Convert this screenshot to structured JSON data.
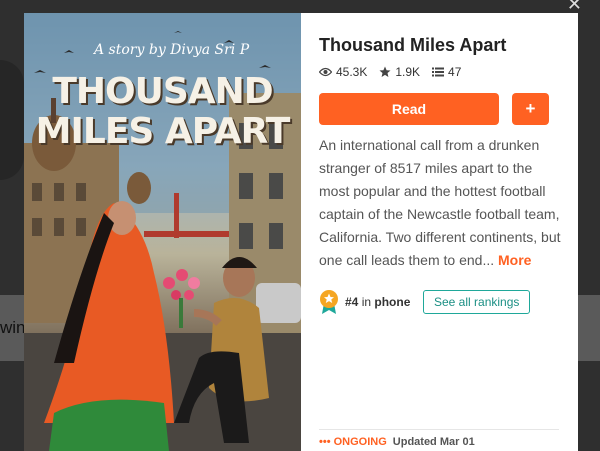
{
  "backdrop": {
    "edge_text": "wing"
  },
  "modal": {
    "cover": {
      "byline": "A story by Divya Sri P",
      "title_line1": "THOUSAND",
      "title_line2": "MILES APART"
    },
    "title": "Thousand Miles Apart",
    "stats": {
      "reads": "45.3K",
      "votes": "1.9K",
      "parts": "47"
    },
    "read_label": "Read",
    "add_label": "+",
    "description": "An international call from a drunken stranger of 8517 miles apart to the most popular and the hottest football captain of the Newcastle football team, California. Two different continents, but one call leads them to end...",
    "more_label": "More",
    "ranking": {
      "rank": "#4",
      "in_text": "in",
      "tag": "phone",
      "see_all_label": "See all rankings"
    },
    "status": {
      "ongoing": "ONGOING",
      "updated": "Updated Mar 01"
    }
  },
  "colors": {
    "accent": "#ff6122",
    "teal": "#1fa89a"
  }
}
